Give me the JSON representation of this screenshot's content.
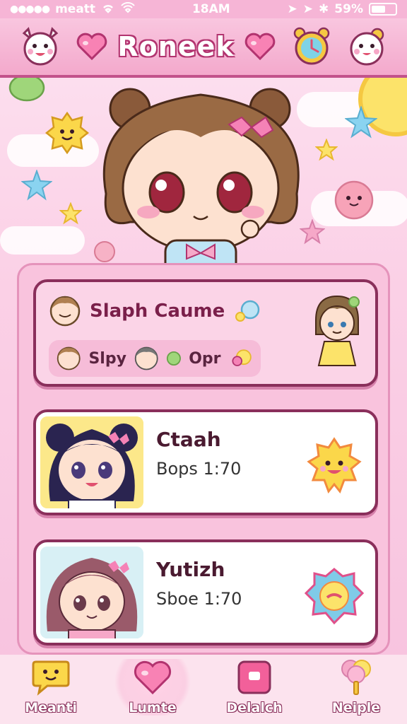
{
  "status_bar": {
    "carrier": "meatt",
    "time": "18AM",
    "battery": "59%",
    "battery_level": 0.59
  },
  "header": {
    "title": "Roneek",
    "left_icon": "mascot-face-icon",
    "heart_icon": "heart-icon",
    "clock_icon": "clock-icon",
    "right_icon": "mascot-face-icon"
  },
  "featured": {
    "title": "Slaph Caume",
    "sub_label": "Slpy",
    "sub_label_2": "Opr"
  },
  "cards": [
    {
      "name": "Ctaah",
      "meta": "Bops 1:70"
    },
    {
      "name": "Yutizh",
      "meta": "Sboe 1:70"
    }
  ],
  "bottom_nav": [
    {
      "label": "Meanti",
      "icon": "chat-bubble-icon"
    },
    {
      "label": "Lumte",
      "icon": "heart-icon"
    },
    {
      "label": "Delalch",
      "icon": "gift-box-icon"
    },
    {
      "label": "Neiple",
      "icon": "cotton-candy-icon"
    }
  ],
  "colors": {
    "accent": "#f3a9cc",
    "border": "#8a2f5b",
    "title_outline": "#b2336f"
  }
}
